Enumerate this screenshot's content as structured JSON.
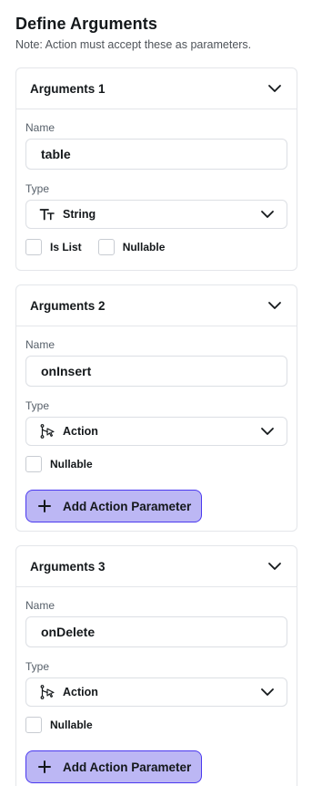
{
  "header": {
    "title": "Define Arguments",
    "note": "Note: Action must accept these as parameters."
  },
  "arguments": [
    {
      "title": "Arguments 1",
      "name_label": "Name",
      "name_value": "table",
      "type_label": "Type",
      "type_value": "String",
      "type_icon": "text-type-icon",
      "checkboxes": [
        "Is List",
        "Nullable"
      ]
    },
    {
      "title": "Arguments 2",
      "name_label": "Name",
      "name_value": "onInsert",
      "type_label": "Type",
      "type_value": "Action",
      "type_icon": "action-icon",
      "checkboxes": [
        "Nullable"
      ],
      "button_label": "Add Action Parameter"
    },
    {
      "title": "Arguments 3",
      "name_label": "Name",
      "name_value": "onDelete",
      "type_label": "Type",
      "type_value": "Action",
      "type_icon": "action-icon",
      "checkboxes": [
        "Nullable"
      ],
      "button_label": "Add Action Parameter"
    }
  ],
  "colors": {
    "accent": "#4b39ef",
    "button_fill": "#bcb7f4",
    "border": "#e4e6ea"
  }
}
